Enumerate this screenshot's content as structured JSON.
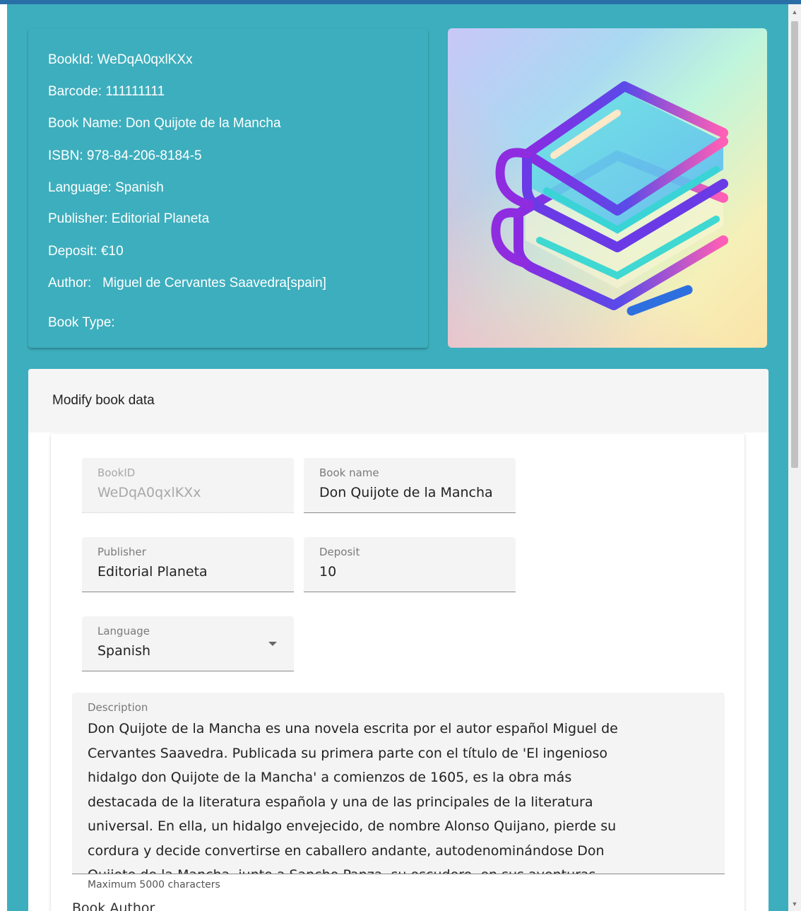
{
  "book_info": {
    "book_id": "BookId: WeDqA0qxlKXx",
    "barcode": "Barcode: 111111111",
    "book_name": "Book Name: Don Quijote de la Mancha",
    "isbn": "ISBN: 978-84-206-8184-5",
    "language": "Language: Spanish",
    "publisher": "Publisher: Editorial Planeta",
    "deposit": "Deposit: €10",
    "author": "Author:   Miguel de Cervantes Saavedra[spain]",
    "book_type": "Book Type:"
  },
  "cover": {
    "icon": "books-stack-icon"
  },
  "modify": {
    "title": "Modify book data",
    "fields": {
      "book_id": {
        "label": "BookID",
        "value": "WeDqA0qxlKXx"
      },
      "book_name": {
        "label": "Book name",
        "value": "Don Quijote de la Mancha"
      },
      "publisher": {
        "label": "Publisher",
        "value": "Editorial Planeta"
      },
      "deposit": {
        "label": "Deposit",
        "value": "10"
      },
      "language": {
        "label": "Language",
        "value": "Spanish"
      }
    },
    "description": {
      "label": "Description",
      "lines": [
        "Don Quijote de la Mancha es una novela escrita por el autor español Miguel de",
        "Cervantes Saavedra. Publicada su primera parte con el título de 'El ingenioso",
        "hidalgo don Quijote de la Mancha' a comienzos de 1605, es la obra más",
        "destacada de la literatura española y una de las principales de la literatura",
        "universal. En ella, un hidalgo envejecido, de nombre Alonso Quijano, pierde su",
        "cordura y decide convertirse en caballero andante, autodenominándose Don",
        "Quijote de la Mancha, junto a Sancho Panza, su escudero, en sus aventuras."
      ],
      "hint": "Maximum 5000 characters"
    },
    "book_author_label": "Book Author"
  },
  "colors": {
    "page_bg": "#3daebd",
    "header_bar": "#2a6ea8",
    "card_bg": "#ffffff",
    "field_bg": "#f4f4f4"
  }
}
